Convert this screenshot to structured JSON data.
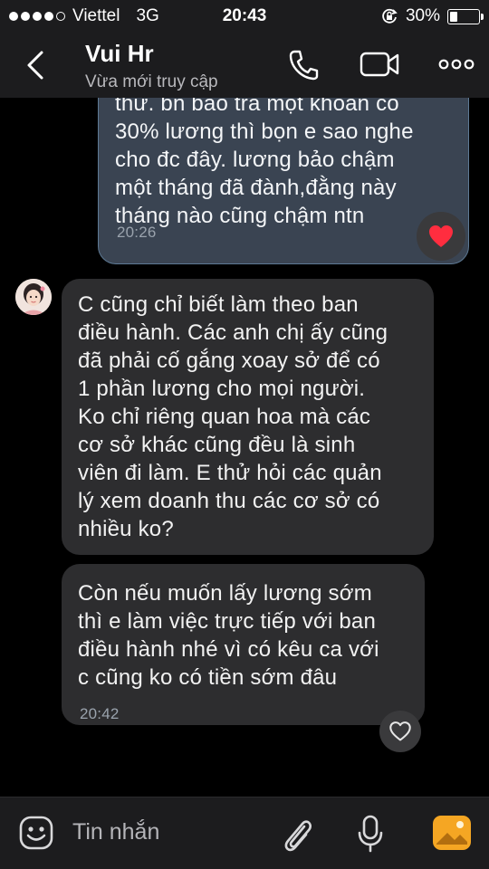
{
  "status_bar": {
    "carrier": "Viettel",
    "network": "3G",
    "time": "20:43",
    "battery": "30%",
    "battery_level": 0.3
  },
  "header": {
    "contact_name": "Vui Hr",
    "status": "Vừa mới truy cập"
  },
  "messages": [
    {
      "direction": "outgoing",
      "text": "thư. bn bảo trả một khoản có\n30% lương thì bọn e sao nghe\ncho đc đây. lương bảo chậm\nmột tháng đã đành,đằng này\ntháng nào cũng chậm ntn",
      "time": "20:26",
      "reaction": "heart"
    },
    {
      "direction": "incoming",
      "text": "C cũng chỉ biết làm theo ban\nđiều hành. Các anh chị ấy cũng\nđã phải cố gắng xoay sở để có\n1 phần lương cho mọi người.\nKo chỉ riêng quan hoa mà các\ncơ sở khác cũng đều là sinh\nviên đi làm. E thử hỏi các quản\nlý xem doanh thu các cơ sở có\nnhiều ko?"
    },
    {
      "direction": "incoming",
      "text": "Còn nếu muốn lấy lương sớm\nthì e làm việc trực tiếp với ban\nđiều hành nhé vì có kêu ca với\nc cũng ko có tiền sớm đâu",
      "time": "20:42"
    }
  ],
  "input_bar": {
    "placeholder": "Tin nhắn"
  },
  "colors": {
    "background": "#000000",
    "bar": "#1c1c1e",
    "outgoing_bubble": "#3a4452",
    "incoming_bubble": "#2d2d2f",
    "heart": "#ff2d3f",
    "photo_icon": "#f5a623"
  }
}
